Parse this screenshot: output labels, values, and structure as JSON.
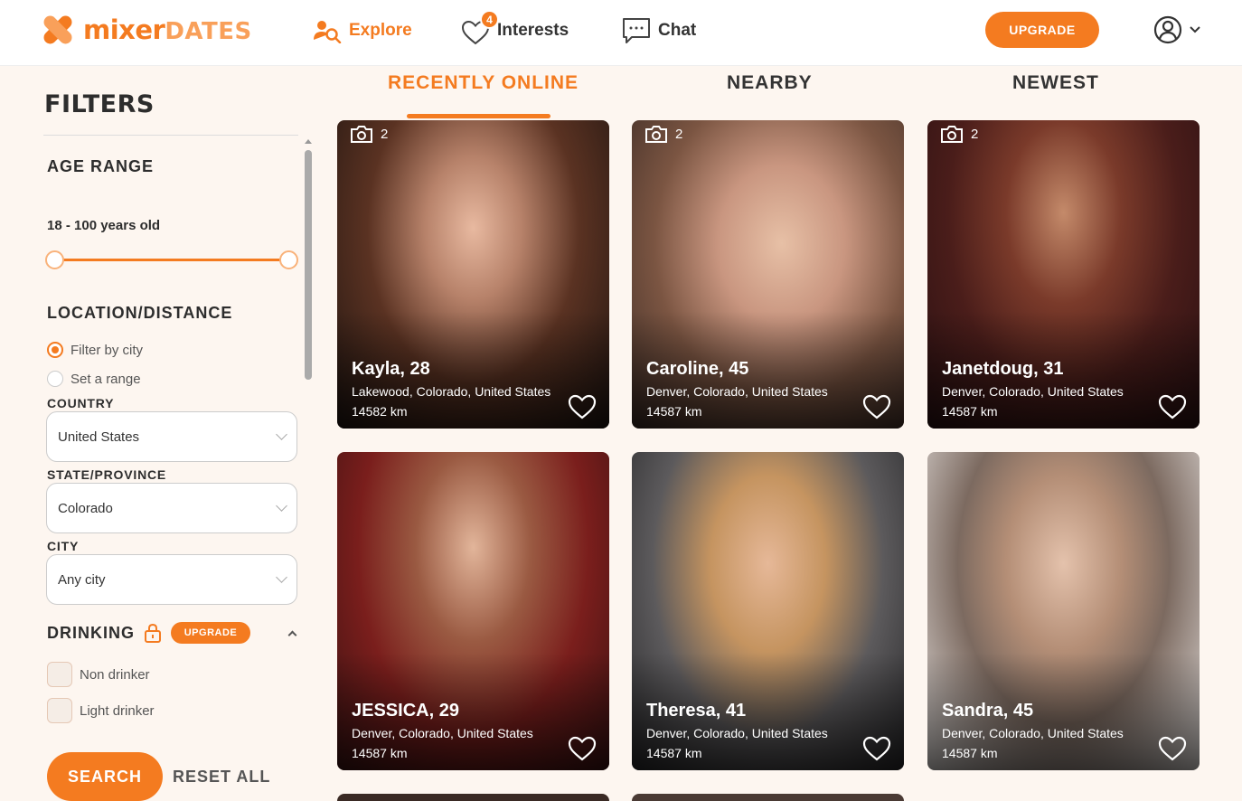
{
  "header": {
    "logo_primary": "mixer",
    "logo_secondary": "DATES",
    "nav": {
      "explore": "Explore",
      "interests": "Interests",
      "interests_badge": "4",
      "chat": "Chat"
    },
    "upgrade_label": "UPGRADE",
    "accent_color": "#f47b20"
  },
  "filters": {
    "title": "FILTERS",
    "age_range_label": "AGE RANGE",
    "age_value": "18 - 100 years old",
    "age_min": 18,
    "age_max": 100,
    "location_label": "LOCATION/DISTANCE",
    "filter_by_city": "Filter by city",
    "set_range": "Set a range",
    "country_label": "COUNTRY",
    "country_value": "United States",
    "state_label": "STATE/PROVINCE",
    "state_value": "Colorado",
    "city_label": "CITY",
    "city_value": "Any city",
    "drinking_label": "DRINKING",
    "drinking_upgrade": "UPGRADE",
    "non_drinker": "Non drinker",
    "light_drinker": "Light drinker",
    "search_label": "SEARCH",
    "reset_label": "RESET ALL"
  },
  "tabs": {
    "recently_online": "RECENTLY ONLINE",
    "nearby": "NEARBY",
    "newest": "NEWEST"
  },
  "profiles": [
    {
      "name": "Kayla, 28",
      "location": "Lakewood, Colorado, United States",
      "distance": "14582 km",
      "photos": "2"
    },
    {
      "name": "Caroline, 45",
      "location": "Denver, Colorado, United States",
      "distance": "14587 km",
      "photos": "2"
    },
    {
      "name": "Janetdoug, 31",
      "location": "Denver, Colorado, United States",
      "distance": "14587 km",
      "photos": "2"
    },
    {
      "name": "JESSICA, 29",
      "location": "Denver, Colorado, United States",
      "distance": "14587 km"
    },
    {
      "name": "Theresa, 41",
      "location": "Denver, Colorado, United States",
      "distance": "14587 km"
    },
    {
      "name": "Sandra, 45",
      "location": "Denver, Colorado, United States",
      "distance": "14587 km"
    }
  ]
}
